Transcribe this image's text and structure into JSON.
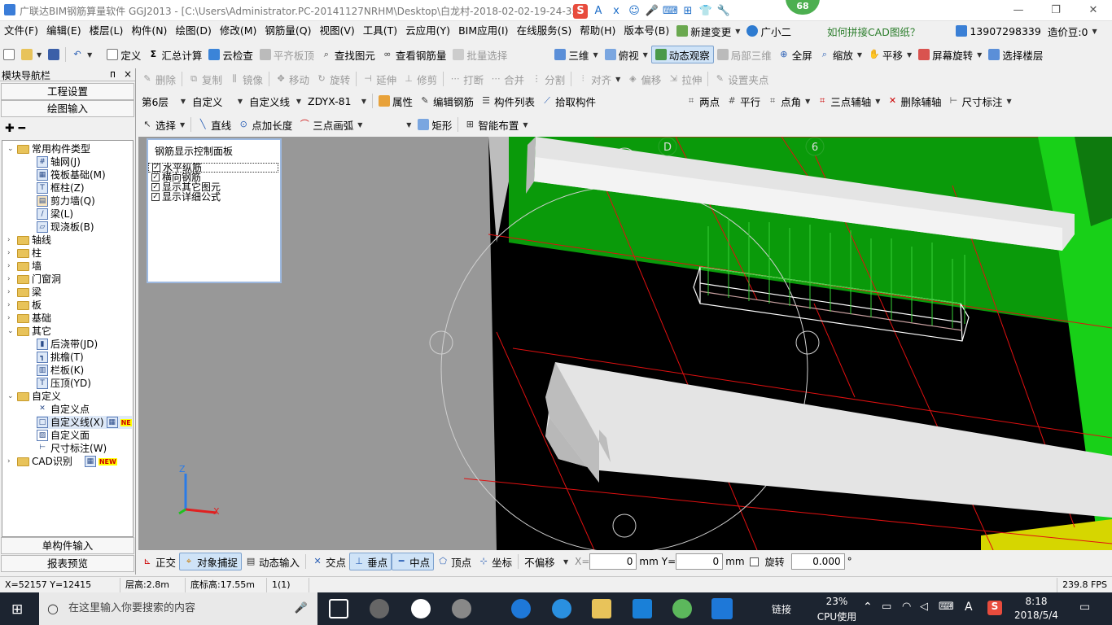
{
  "window": {
    "title": "广联达BIM钢筋算量软件 GGJ2013 - [C:\\Users\\Administrator.PC-20141127NRHM\\Desktop\\白龙村-2018-02-02-19-24-35",
    "badge": "68",
    "minimize": "—",
    "restore": "❐",
    "close": "✕"
  },
  "ime": {
    "logo": "S",
    "icons": [
      "A",
      "ⅹ",
      "☺",
      "🎤",
      "⌨",
      "⊞",
      "👕",
      "🔧"
    ]
  },
  "menu": {
    "items": [
      "文件(F)",
      "编辑(E)",
      "楼层(L)",
      "构件(N)",
      "绘图(D)",
      "修改(M)",
      "钢筋量(Q)",
      "视图(V)",
      "工具(T)",
      "云应用(Y)",
      "BIM应用(I)",
      "在线服务(S)",
      "帮助(H)",
      "版本号(B)"
    ],
    "new_change": "新建变更",
    "xiaoer": "广小二",
    "cad_help": "如何拼接CAD图纸？",
    "phone": "13907298339",
    "beans": "造价豆:0"
  },
  "toolbar1": {
    "define": "定义",
    "calc": "汇总计算",
    "cloud_check": "云检查",
    "flat_top": "平齐板顶",
    "find": "查找图元",
    "view_rebar": "查看钢筋量",
    "batch": "批量选择",
    "3d": "三维",
    "top_view": "俯视",
    "dynamic": "动态观察",
    "local3d": "局部三维",
    "fullscreen": "全屏",
    "zoom": "缩放",
    "pan": "平移",
    "rotate_screen": "屏幕旋转",
    "select_floor": "选择楼层"
  },
  "toolbar2": {
    "items": [
      "删除",
      "复制",
      "镜像",
      "移动",
      "旋转",
      "延伸",
      "修剪",
      "打断",
      "合并",
      "分割",
      "对齐",
      "偏移",
      "拉伸",
      "设置夹点"
    ]
  },
  "toolbar3": {
    "floor": "第6层",
    "type": "自定义",
    "sub": "自定义线",
    "code": "ZDYX-81",
    "props": "属性",
    "edit_rebar": "编辑钢筋",
    "list": "构件列表",
    "pick": "拾取构件",
    "two_points": "两点",
    "parallel": "平行",
    "point_angle": "点角",
    "three_axis": "三点辅轴",
    "del_axis": "删除辅轴",
    "dim": "尺寸标注"
  },
  "toolbar4": {
    "select": "选择",
    "line": "直线",
    "point_len": "点加长度",
    "arc": "三点画弧",
    "rect": "矩形",
    "smart": "智能布置"
  },
  "nav": {
    "title": "模块导航栏",
    "pin": "ᴨ",
    "close": "×",
    "btn_settings": "工程设置",
    "btn_draw": "绘图输入",
    "btn_single": "单构件输入",
    "btn_report": "报表预览"
  },
  "tree": {
    "common": "常用构件类型",
    "axis_grid": "轴网(J)",
    "raft": "筏板基础(M)",
    "frame_col": "框柱(Z)",
    "shear_wall": "剪力墙(Q)",
    "beam_l": "梁(L)",
    "cast_slab": "现浇板(B)",
    "axis": "轴线",
    "col": "柱",
    "wall": "墙",
    "door": "门窗洞",
    "beam": "梁",
    "slab": "板",
    "found": "基础",
    "other": "其它",
    "post_pour": "后浇带(JD)",
    "eave": "挑檐(T)",
    "rail": "栏板(K)",
    "cap": "压顶(YD)",
    "custom": "自定义",
    "cpoint": "自定义点",
    "cline": "自定义线(X)",
    "cface": "自定义面",
    "dimw": "尺寸标注(W)",
    "cad": "CAD识别",
    "new1": "NE",
    "new2": "NEW"
  },
  "panel": {
    "title": "钢筋显示控制面板",
    "opts": [
      "水平纵筋",
      "横向钢筋",
      "显示其它图元",
      "显示详细公式"
    ]
  },
  "viewport": {
    "axis_d": "D",
    "axis_6": "6",
    "z": "Z",
    "x": "X"
  },
  "snap": {
    "ortho": "正交",
    "snap_obj": "对象捕捉",
    "dyn_input": "动态输入",
    "intersect": "交点",
    "perp": "垂点",
    "mid": "中点",
    "vertex": "顶点",
    "coord": "坐标",
    "no_offset": "不偏移",
    "x_label": "X=",
    "x_val": "0",
    "y_label": "Y=",
    "y_val": "0",
    "unit": "mm",
    "rotate": "旋转",
    "rot_val": "0.000",
    "deg": "°"
  },
  "status": {
    "coords": "X=52157 Y=12415",
    "floor_h": "层高:2.8m",
    "base_h": "底标高:17.55m",
    "count": "1(1)",
    "fps": "239.8 FPS"
  },
  "taskbar": {
    "search": "在这里输入你要搜索的内容",
    "link": "链接",
    "cpu": "23%",
    "cpu_label": "CPU使用",
    "time": "8:18",
    "date": "2018/5/4"
  },
  "colors": {
    "green": "#0a9a0a",
    "bright_green": "#18d018",
    "grid_red": "#e01010",
    "beam": "#e4e4e4"
  }
}
